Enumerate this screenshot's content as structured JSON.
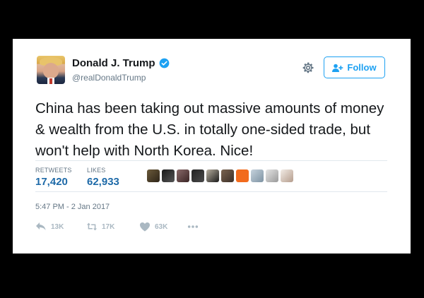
{
  "tweet": {
    "author": {
      "display_name": "Donald J. Trump",
      "handle": "@realDonaldTrump",
      "verified": true
    },
    "follow_label": "Follow",
    "text": "China has been taking out massive amounts of money & wealth from the U.S. in totally one-sided trade, but won't help with North Korea. Nice!",
    "stats": {
      "retweets_label": "RETWEETS",
      "retweets_value": "17,420",
      "likes_label": "LIKES",
      "likes_value": "62,933"
    },
    "timestamp": "5:47 PM - 2 Jan 2017",
    "actions": {
      "reply_count": "13K",
      "retweet_count": "17K",
      "like_count": "63K"
    }
  },
  "colors": {
    "accent": "#1da1f2",
    "stat_value": "#1e6aa8",
    "muted": "#657786",
    "icon_muted": "#aab8c2",
    "background": "#000000",
    "card": "#ffffff"
  },
  "icons": {
    "verified": "verified-badge-icon",
    "settings": "gear-icon",
    "follow": "add-user-icon",
    "reply": "reply-icon",
    "retweet": "retweet-icon",
    "like": "heart-icon",
    "more": "more-icon"
  }
}
